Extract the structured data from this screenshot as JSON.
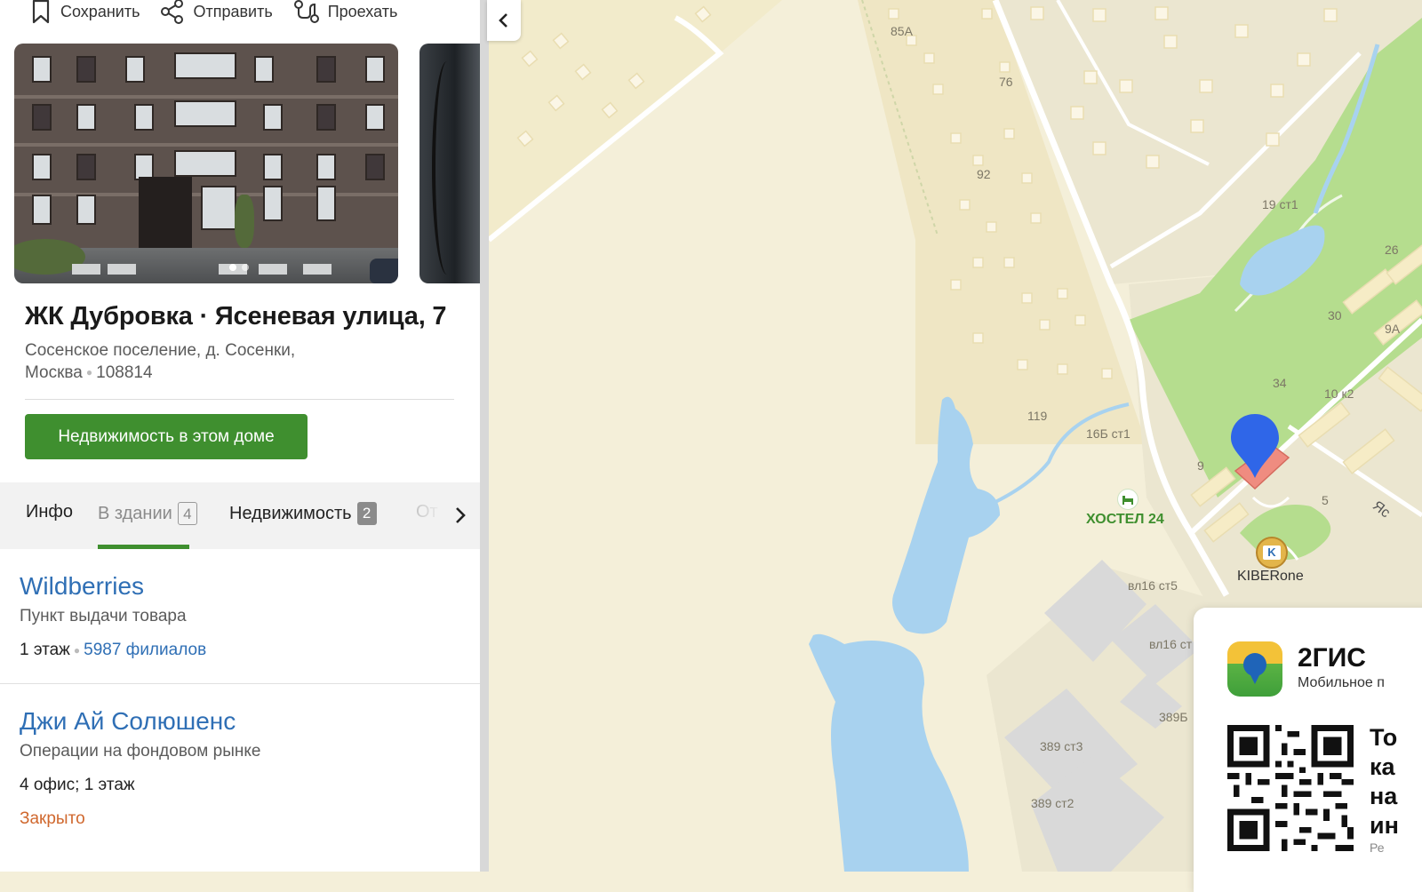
{
  "actions": {
    "save": "Сохранить",
    "share": "Отправить",
    "route": "Проехать"
  },
  "place": {
    "title": "ЖК Дубровка · Ясеневая улица, 7",
    "address_line1": "Сосенское поселение, д. Сосенки,",
    "city": "Москва",
    "postcode": "108814",
    "realty_button": "Недвижимость в этом доме"
  },
  "tabs": [
    {
      "label": "Инфо"
    },
    {
      "label": "В здании",
      "count": "4"
    },
    {
      "label": "Недвижимость",
      "count": "2"
    },
    {
      "label": "От"
    }
  ],
  "listing": [
    {
      "name": "Wildberries",
      "category": "Пункт выдачи товара",
      "floor": "1 этаж",
      "branches": "5987 филиалов"
    },
    {
      "name": "Джи Ай Солюшенс",
      "category": "Операции на фондовом рынке",
      "floor": "4 офис; 1 этаж",
      "status": "Закрыто"
    }
  ],
  "map": {
    "labels": [
      "85А",
      "76",
      "92",
      "119",
      "16Б ст1",
      "19 ст1",
      "30",
      "34",
      "10 к2",
      "9",
      "5",
      "вл16 ст5",
      "вл16 ст",
      "389Б",
      "389 ст3",
      "389 ст2",
      "26",
      "9А",
      "Яс"
    ],
    "poi_hostel": "ХОСТЕЛ 24",
    "poi_kiber": "KIBERone",
    "colors": {
      "water": "#a8d2ef",
      "park": "#b5dd8e",
      "land": "#f4efd9",
      "residential": "#f2ebcb",
      "marker": "#2f66e8"
    }
  },
  "promo": {
    "brand": "2ГИС",
    "subtitle": "Мобильное п",
    "text_lines": "То\nка\nна\nин",
    "small": "Ре"
  }
}
